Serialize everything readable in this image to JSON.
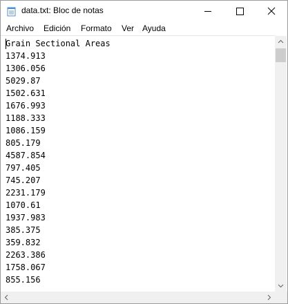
{
  "window": {
    "title": "data.txt: Bloc de notas"
  },
  "menu": [
    "Archivo",
    "Edición",
    "Formato",
    "Ver",
    "Ayuda"
  ],
  "document": {
    "lines": [
      "Grain Sectional Areas",
      "1374.913",
      "1306.056",
      "5029.87",
      "1502.631",
      "1676.993",
      "1188.333",
      "1086.159",
      "805.179",
      "4587.854",
      "797.405",
      "745.207",
      "2231.179",
      "1070.61",
      "1937.983",
      "385.375",
      "359.832",
      "2263.386",
      "1758.067",
      "855.156"
    ]
  },
  "icons": {
    "app": "notepad-icon",
    "minimize": "minimize-icon",
    "maximize": "maximize-icon",
    "close": "close-icon",
    "scroll_up": "scroll-up-arrow-icon",
    "scroll_down": "scroll-down-arrow-icon",
    "scroll_left": "scroll-left-arrow-icon",
    "scroll_right": "scroll-right-arrow-icon"
  }
}
